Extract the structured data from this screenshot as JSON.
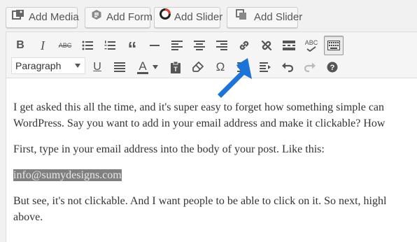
{
  "media_buttons": [
    {
      "label": "Add Media"
    },
    {
      "label": "Add Form"
    },
    {
      "label": "Add Slider"
    },
    {
      "label": "Add Slider"
    }
  ],
  "toolbar": {
    "format_select": {
      "value": "Paragraph"
    },
    "row1_icons": [
      "bold-icon",
      "italic-icon",
      "strikethrough-icon",
      "bullet-list-icon",
      "numbered-list-icon",
      "blockquote-icon",
      "horizontal-line-icon",
      "align-left-icon",
      "align-center-icon",
      "align-right-icon",
      "insert-link-icon",
      "remove-link-icon",
      "read-more-icon",
      "spellcheck-icon",
      "toolbar-toggle-icon"
    ],
    "row2_icons": [
      "underline-icon",
      "justify-icon",
      "text-color-icon",
      "paste-text-icon",
      "clear-formatting-icon",
      "special-character-icon",
      "outdent-icon",
      "indent-icon",
      "undo-icon",
      "redo-icon",
      "help-icon"
    ],
    "spellcheck_text": "ABC",
    "strikethrough_text": "ABC",
    "text_color_letter": "A",
    "special_char": "Ω"
  },
  "annotation": {
    "arrow_color": "#1e73d8"
  },
  "content": {
    "p1_line1": "I get asked this all the time, and it's super easy to forget how something simple can",
    "p1_line2": "WordPress. Say you want to add in your email address and make it clickable? How",
    "p2": "First, type in your email address into the body of your post. Like this:",
    "email": "info@sumydesigns.com",
    "p4_line1": "But see, it's not clickable. And I want people to be able to click on it. So next, highl",
    "p4_line2": "above."
  }
}
